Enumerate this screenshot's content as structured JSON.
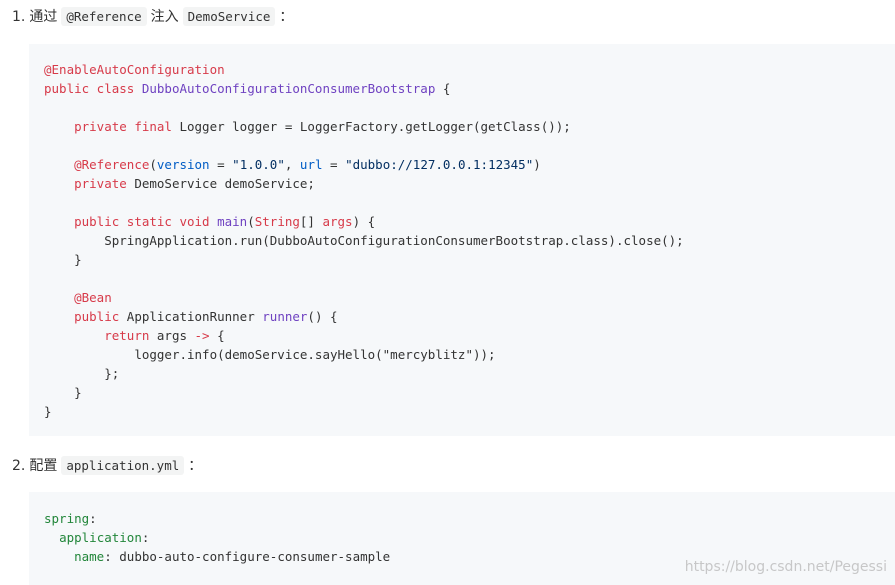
{
  "step1": {
    "num": "1.",
    "text_before": "通过",
    "code1": "@Reference",
    "text_mid": "注入",
    "code2": "DemoService",
    "text_after": "："
  },
  "java": {
    "l1": "@EnableAutoConfiguration",
    "l2_kw": "public class",
    "l2_name": "DubboAutoConfigurationConsumerBootstrap",
    "l2_rest": " {",
    "l3_kw": "private final",
    "l3_rest": " Logger logger = LoggerFactory.getLogger(getClass());",
    "l4_ann": "@Reference",
    "l4_p1": "(",
    "l4_attr1": "version",
    "l4_eq1": " = ",
    "l4_val1": "\"1.0.0\"",
    "l4_c": ", ",
    "l4_attr2": "url",
    "l4_eq2": " = ",
    "l4_val2": "\"dubbo://127.0.0.1:12345\"",
    "l4_p2": ")",
    "l5_kw": "private",
    "l5_rest": " DemoService demoService;",
    "l6_kw": "public static void",
    "l6_name": "main",
    "l6_p1": "(",
    "l6_type": "String",
    "l6_arr": "[] ",
    "l6_param": "args",
    "l6_rest": ") {",
    "l7": "SpringApplication.run(DubboAutoConfigurationConsumerBootstrap.class).close();",
    "l8": "}",
    "l9": "@Bean",
    "l10_kw": "public",
    "l10_mid": " ApplicationRunner ",
    "l10_name": "runner",
    "l10_rest": "() {",
    "l11_kw": "return",
    "l11_mid": " args ",
    "l11_op": "->",
    "l11_rest": " {",
    "l12": "logger.info(demoService.sayHello(\"mercyblitz\"));",
    "l13": "};",
    "l14": "}",
    "l15": "}"
  },
  "step2": {
    "num": "2.",
    "text_before": "配置",
    "code1": "application.yml",
    "text_after": "："
  },
  "yaml": {
    "k1": "spring",
    "c1": ":",
    "k2": "application",
    "c2": ":",
    "k3": "name",
    "c3": ":",
    "v3": " dubbo-auto-configure-consumer-sample"
  },
  "watermark": "https://blog.csdn.net/Pegessi"
}
